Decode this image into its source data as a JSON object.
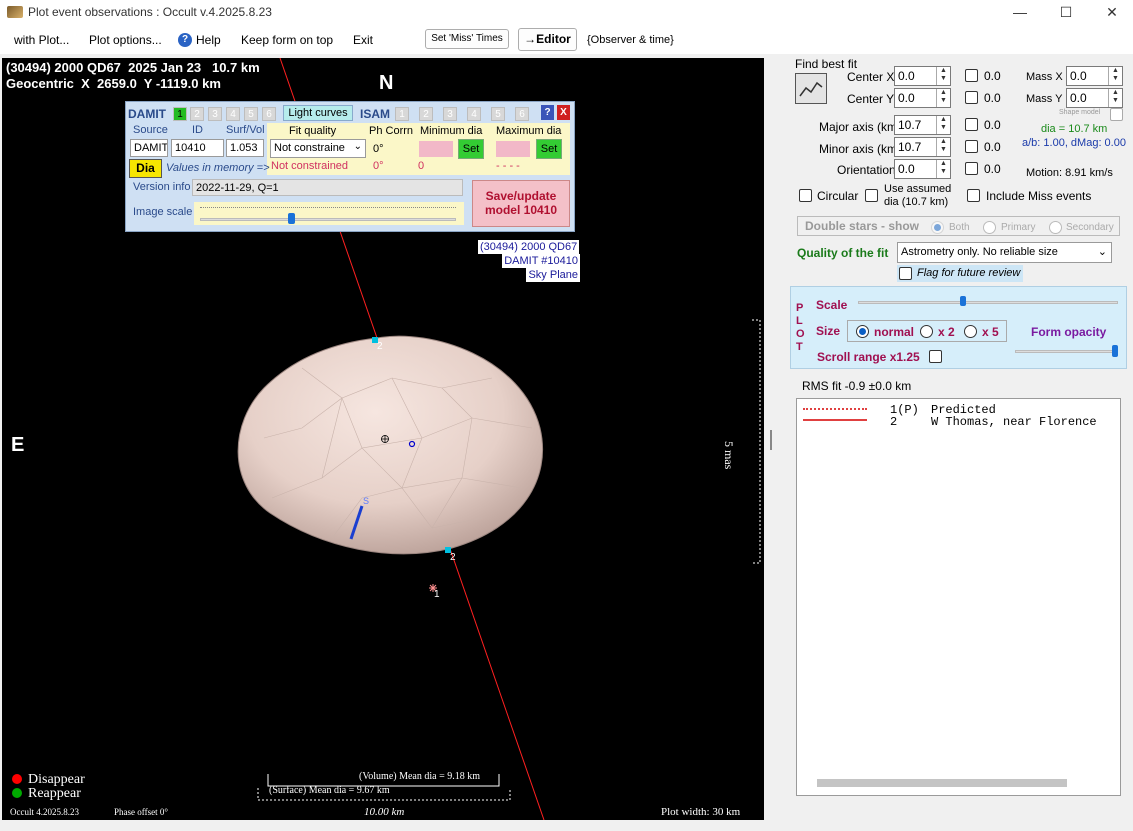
{
  "window": {
    "title": "Plot event observations : Occult v.4.2025.8.23",
    "minimize": "—",
    "maximize": "☐",
    "close": "✕"
  },
  "menu": {
    "with_plot": "with Plot...",
    "plot_options": "Plot options...",
    "help": "Help",
    "keep_on_top": "Keep form on top",
    "exit": "Exit",
    "set_miss_times": "Set 'Miss' Times",
    "editor": "→Editor",
    "observer_time": "{Observer & time}"
  },
  "plot": {
    "header_line1": "(30494) 2000 QD67  2025 Jan 23   10.7 km",
    "header_line2": "Geocentric  X  2659.0  Y -1119.0 km",
    "north": "N",
    "east": "E",
    "info_label_1": "(30494) 2000 QD67",
    "info_label_2": "DAMIT #10410",
    "info_label_3": "Sky Plane",
    "scale_label": "5 mas",
    "chord_2_top": "2",
    "chord_2_bottom": "2",
    "chord_1": "1",
    "s_marker": "S",
    "legend_disappear": "Disappear",
    "legend_reappear": "Reappear",
    "volume_mean": "(Volume) Mean dia = 9.18 km",
    "surface_mean": "(Surface) Mean dia = 9.67 km",
    "scale_bar": "10.00 km",
    "version": "Occult 4.2025.8.23",
    "phase": "Phase offset 0°",
    "plot_width": "Plot width: 30 km",
    "colors": {
      "background": "#000000",
      "chord": "#ff2020",
      "shape": "#e8d4cc",
      "disappear": "#ff0000",
      "reappear": "#00aa00"
    }
  },
  "damit_panel": {
    "damit_label": "DAMIT",
    "damit_numbers": [
      "1",
      "2",
      "3",
      "4",
      "5",
      "6"
    ],
    "light_curves": "Light curves",
    "isam_label": "ISAM",
    "isam_numbers": [
      "1",
      "2",
      "3",
      "4",
      "5",
      "6"
    ],
    "help_btn": "?",
    "close_btn": "X",
    "col_source": "Source",
    "col_id": "ID",
    "col_surfvol": "Surf/Vol",
    "col_fit_quality": "Fit quality",
    "col_ph_corrn": "Ph Corrn",
    "col_min_dia": "Minimum dia",
    "col_max_dia": "Maximum dia",
    "source_value": "DAMIT",
    "id_value": "10410",
    "surfvol_value": "1.053",
    "fit_quality_value": "Not constraine",
    "ph_corrn_value": "0°",
    "set_min": "Set",
    "set_max": "Set",
    "dia_button": "Dia",
    "values_in_memory": "Values in memory =>",
    "mem_fit": "Not constrained",
    "mem_ph": "0°",
    "mem_min": "0",
    "mem_max": "- - - -",
    "version_info_label": "Version info",
    "version_info_value": "2022-11-29, Q=1",
    "image_scale_label": "Image scale",
    "save_button": "Save/update model 10410",
    "image_scale_fraction": 0.35
  },
  "right_panel": {
    "find_best_fit": "Find best fit",
    "center_x": "Center X",
    "center_x_value": "0.0",
    "center_x_chk": "0.0",
    "center_y": "Center Y",
    "center_y_value": "0.0",
    "center_y_chk": "0.0",
    "mass_x": "Mass X",
    "mass_x_value": "0.0",
    "mass_y": "Mass Y",
    "mass_y_value": "0.0",
    "shape_model": "Shape model",
    "major_axis": "Major axis (km)",
    "major_axis_value": "10.7",
    "major_chk": "0.0",
    "minor_axis": "Minor axis (km)",
    "minor_axis_value": "10.7",
    "minor_chk": "0.0",
    "orientation": "Orientation",
    "orientation_value": "0.0",
    "orient_chk": "0.0",
    "dia_info": "dia = 10.7 km",
    "ab_info": "a/b: 1.00, dMag: 0.00",
    "motion": "Motion: 8.91 km/s",
    "circular": "Circular",
    "use_assumed": "Use assumed",
    "use_assumed_2": "dia (10.7 km)",
    "include_miss": "Include Miss events",
    "double_stars": "Double stars - show",
    "both": "Both",
    "primary": "Primary",
    "secondary": "Secondary",
    "quality_label": "Quality of the fit",
    "quality_value": "Astrometry only. No reliable size",
    "flag_review": "Flag for future review",
    "plot_letters": [
      "P",
      "L",
      "O",
      "T"
    ],
    "scale": "Scale",
    "size": "Size",
    "size_normal": "normal",
    "size_x2": "x 2",
    "size_x5": "x 5",
    "form_opacity": "Form opacity",
    "scroll_range": "Scroll range x1.25",
    "rms_fit": "RMS fit -0.9 ±0.0 km",
    "scale_fraction": 0.4,
    "opacity_fraction": 1.0,
    "legend_rows": [
      {
        "id": "1(P)",
        "name": "Predicted",
        "style": "dotted"
      },
      {
        "id": "2",
        "name": "W Thomas, near Florence",
        "style": "solid"
      }
    ]
  }
}
